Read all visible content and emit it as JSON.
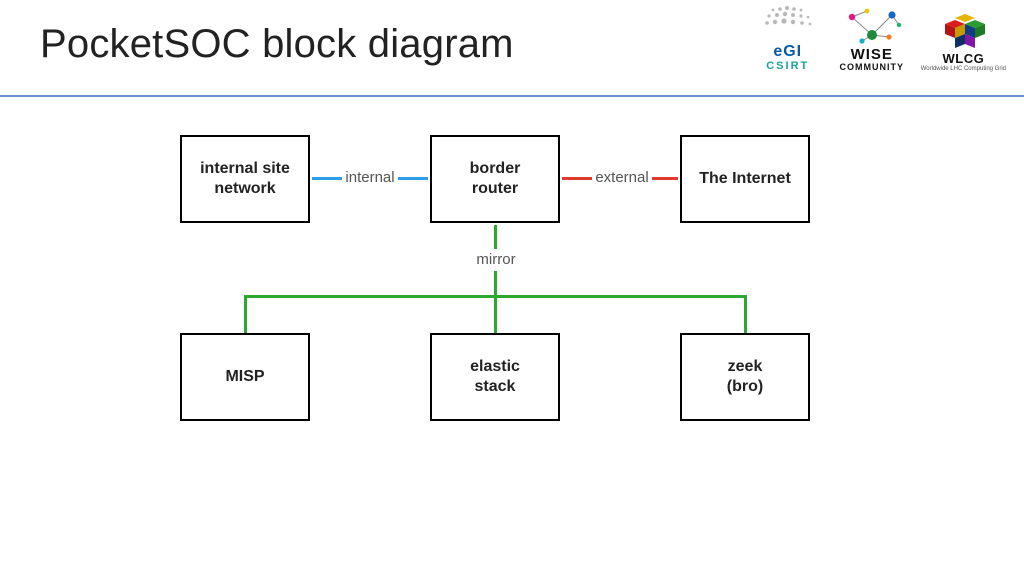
{
  "header": {
    "title": "PocketSOC block diagram"
  },
  "logos": {
    "egi": {
      "line1": "eGI",
      "line2": "CSIRT"
    },
    "wise": {
      "line1": "WISE",
      "line2": "COMMUNITY"
    },
    "wlcg": {
      "line1": "WLCG",
      "line2": "Worldwide LHC Computing Grid"
    }
  },
  "diagram": {
    "blocks": {
      "internal_site_network": "internal site\nnetwork",
      "border_router": "border\nrouter",
      "the_internet": "The Internet",
      "misp": "MISP",
      "elastic_stack": "elastic\nstack",
      "zeek": "zeek\n(bro)"
    },
    "edges": {
      "internal": "internal",
      "external": "external",
      "mirror": "mirror"
    },
    "colors": {
      "internal": "#2e9ee6",
      "external": "#e03a2e",
      "mirror": "#2aa82f"
    }
  },
  "chart_data": {
    "type": "diagram",
    "nodes": [
      {
        "id": "internal_site_network",
        "label": "internal site network"
      },
      {
        "id": "border_router",
        "label": "border router"
      },
      {
        "id": "the_internet",
        "label": "The Internet"
      },
      {
        "id": "misp",
        "label": "MISP"
      },
      {
        "id": "elastic_stack",
        "label": "elastic stack"
      },
      {
        "id": "zeek",
        "label": "zeek (bro)"
      }
    ],
    "edges": [
      {
        "from": "internal_site_network",
        "to": "border_router",
        "label": "internal",
        "color": "#2e9ee6"
      },
      {
        "from": "border_router",
        "to": "the_internet",
        "label": "external",
        "color": "#e03a2e"
      },
      {
        "from": "border_router",
        "to": "misp",
        "label": "mirror",
        "color": "#2aa82f"
      },
      {
        "from": "border_router",
        "to": "elastic_stack",
        "label": "mirror",
        "color": "#2aa82f"
      },
      {
        "from": "border_router",
        "to": "zeek",
        "label": "mirror",
        "color": "#2aa82f"
      }
    ]
  }
}
